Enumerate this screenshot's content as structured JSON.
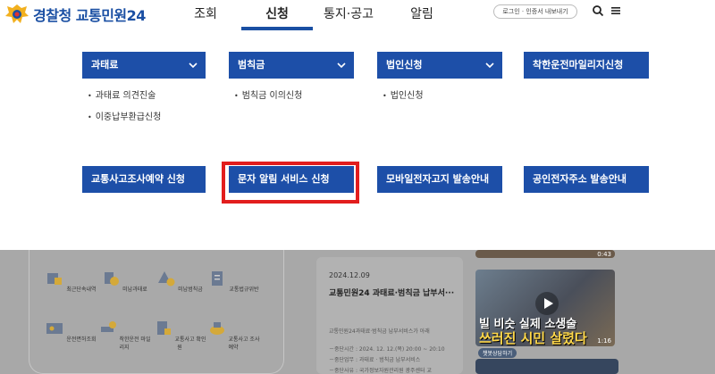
{
  "logo": {
    "org": "경찰청",
    "service": "교통민원24"
  },
  "nav": {
    "items": [
      "조회",
      "신청",
      "통지·공고",
      "알림"
    ],
    "active": "신청"
  },
  "header": {
    "login_label": "로그인 · 인증서 내보내기",
    "search_icon": "search-icon",
    "menu_icon": "hamburger-menu-icon"
  },
  "menu": {
    "categories": [
      {
        "label": "과태료",
        "expandable": true
      },
      {
        "label": "범칙금",
        "expandable": true
      },
      {
        "label": "법인신청",
        "expandable": true
      },
      {
        "label": "착한운전마일리지신청",
        "expandable": false
      },
      {
        "label": "교통사고조사예약 신청",
        "expandable": false
      },
      {
        "label": "문자 알림 서비스 신청",
        "expandable": false
      },
      {
        "label": "모바일전자고지 발송안내",
        "expandable": false
      },
      {
        "label": "공인전자주소 발송안내",
        "expandable": false
      }
    ],
    "sub_items": {
      "fine": [
        "과태료 의견진술",
        "이중납부환급신청"
      ],
      "penalty": [
        "범칙금 이의신청"
      ],
      "corp": [
        "법인신청"
      ]
    },
    "highlight_color": "#e21d1d",
    "accent_color": "#1d4fa8"
  },
  "shortcuts": [
    "최근단속내역",
    "미납과태료",
    "미납범칙금",
    "교통법규위반",
    "운전면허조회",
    "착한운전 마일리지",
    "교통사고 확인원",
    "교통사고 조사예약"
  ],
  "news": {
    "date": "2024.12.09",
    "title": "교통민원24 과태료·범칙금 납부서···",
    "lines": [
      "교통민원24과태료·범칙금 납부서비스가 아래",
      "－중단시간 : 2024. 12. 12.(목) 20:00 ~ 20:10",
      "－중단업무 : 과태료 · 범칙금 납부서비스",
      "－중단사유 : 국가정보자원관리원 광주센터 교"
    ]
  },
  "videos": [
    {
      "time": "0:43"
    },
    {
      "caption_top": "빌 비슷 실제 소생술",
      "caption_bottom": "쓰러진 시민 살렸다",
      "time": "1:16"
    }
  ],
  "chat_badge": "챗봇상담하기"
}
